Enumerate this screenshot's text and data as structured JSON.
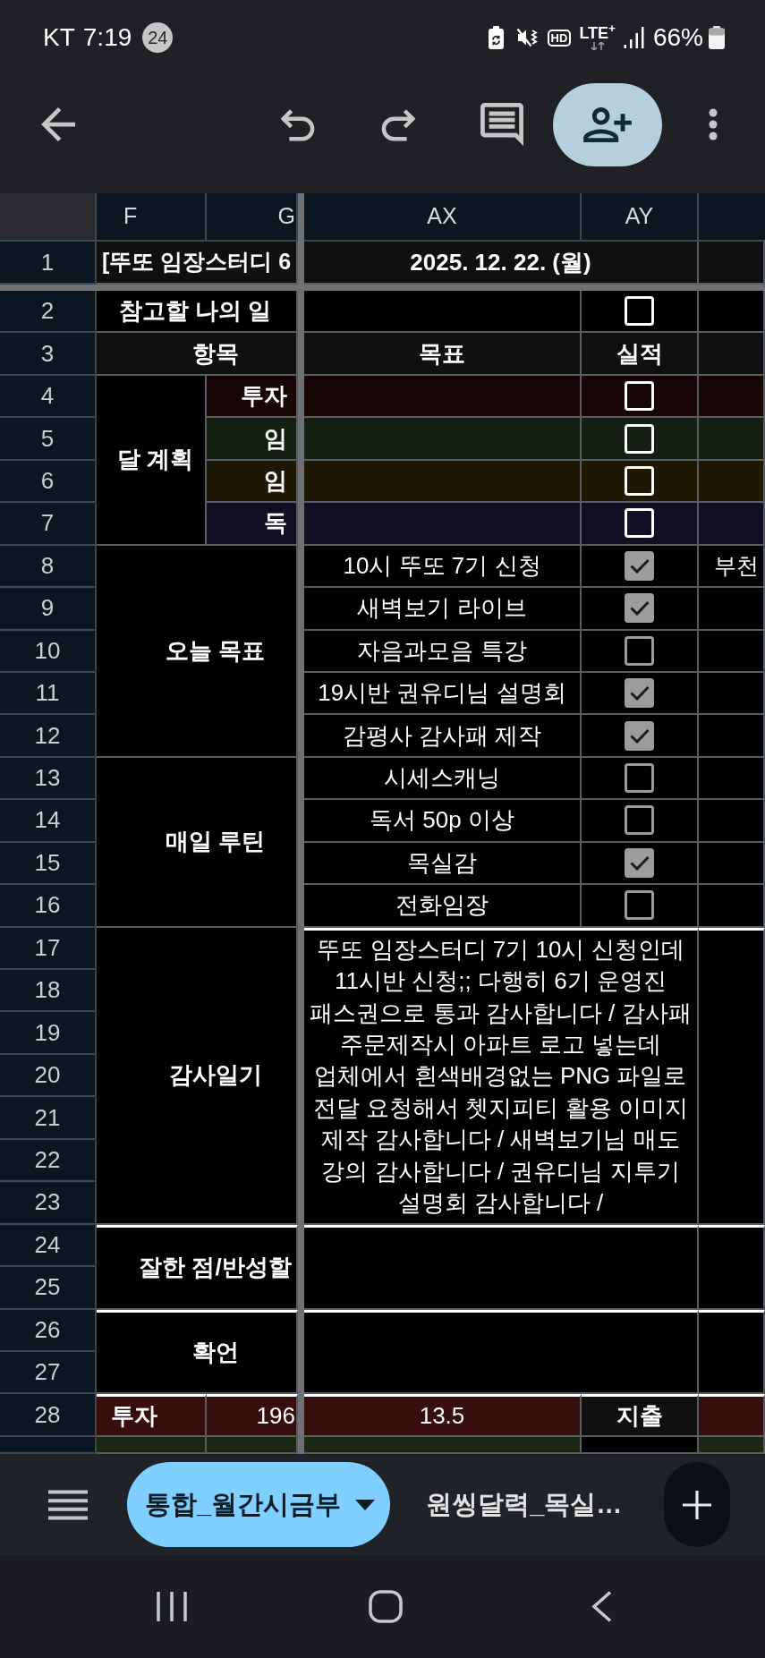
{
  "status_bar": {
    "carrier": "KT",
    "time": "7:19",
    "notification_count": "24",
    "hd_badge": "HD",
    "network": "LTE$^{+}$",
    "battery": "66%"
  },
  "sheet": {
    "column_headers": [
      "F",
      "G",
      "AX",
      "AY"
    ],
    "title_row": {
      "row": "1",
      "title": "[뚜또 임장스터디 6",
      "date": "2025. 12. 22. (월)"
    },
    "schedule_row": {
      "row": "2",
      "label": "참고할 나의 일",
      "checked": false
    },
    "header_row": {
      "row": "3",
      "item": "항목",
      "goal": "목표",
      "result": "실적"
    },
    "monthly_plan": {
      "label": "달 계획",
      "rows": [
        {
          "row": "4",
          "category": "투자",
          "color": "#180506",
          "checked": false
        },
        {
          "row": "5",
          "category": "임",
          "color": "#132012",
          "checked": false
        },
        {
          "row": "6",
          "category": "임",
          "color": "#1f1804",
          "checked": false
        },
        {
          "row": "7",
          "category": "독",
          "color": "#120f24",
          "checked": false
        }
      ]
    },
    "sections": [
      {
        "label": "오늘 목표",
        "tasks": [
          {
            "row": "8",
            "text": "10시 뚜또 7기 신청",
            "checked": true,
            "note": "부천"
          },
          {
            "row": "9",
            "text": "새벽보기 라이브",
            "checked": true
          },
          {
            "row": "10",
            "text": "자음과모음 특강",
            "checked": false
          },
          {
            "row": "11",
            "text": "19시반 권유디님 설명회",
            "checked": true
          },
          {
            "row": "12",
            "text": "감평사 감사패 제작",
            "checked": true
          }
        ]
      },
      {
        "label": "매일 루틴",
        "tasks": [
          {
            "row": "13",
            "text": "시세스캐닝",
            "checked": false
          },
          {
            "row": "14",
            "text": "독서 50p 이상",
            "checked": false
          },
          {
            "row": "15",
            "text": "목실감",
            "checked": true
          },
          {
            "row": "16",
            "text": "전화임장",
            "checked": false
          }
        ]
      }
    ],
    "diary": {
      "rows": [
        "17",
        "18",
        "19",
        "20",
        "21",
        "22",
        "23"
      ],
      "label": "감사일기",
      "text": "뚜또 임장스터디 7기 10시 신청인데 11시반 신청;; 다행히 6기 운영진 패스권으로 통과 감사합니다 / 감사패 주문제작시 아파트 로고 넣는데 업체에서 흰색배경없는 PNG 파일로 전달 요청해서 쳇지피티 활용 이미지 제작 감사합니다 / 새벽보기님 매도 강의 감사합니다 / 권유디님 지투기 설명회 감사합니다 /"
    },
    "reflection": {
      "rows": [
        "24",
        "25"
      ],
      "label": "잘한 점/반성할"
    },
    "affirmation": {
      "rows": [
        "26",
        "27"
      ],
      "label": "확언"
    },
    "summary_rows": [
      {
        "row": "28",
        "label": "투자",
        "value": "196",
        "amount": "13.5",
        "side_label": "지출",
        "color": "#370d0d"
      },
      {
        "color": "#1b2914"
      }
    ]
  },
  "sheet_tabs": [
    {
      "label": "통합_월간시금부",
      "selected": true
    },
    {
      "label": "원씽달력_목실…",
      "selected": false
    }
  ]
}
